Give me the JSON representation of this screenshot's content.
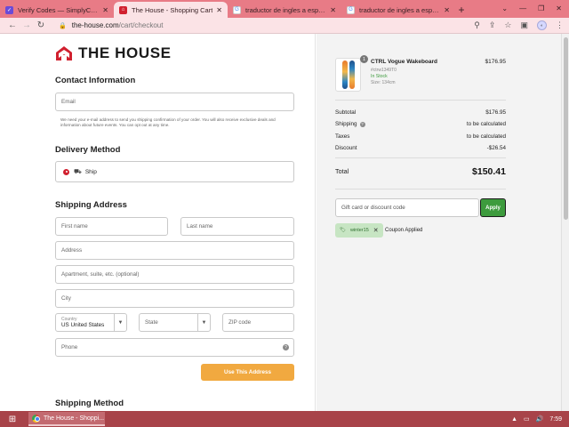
{
  "browser": {
    "tabs": [
      {
        "title": "Verify Codes — SimplyCodes",
        "favicon_color": "#6a4bd8",
        "active": false
      },
      {
        "title": "The House - Shopping Cart",
        "favicon_color": "#d1202f",
        "active": true
      },
      {
        "title": "traductor de ingles a español -",
        "favicon_color": "#4285f4",
        "active": false
      },
      {
        "title": "traductor de ingles a español -",
        "favicon_color": "#4285f4",
        "active": false
      }
    ],
    "new_tab_label": "+",
    "url_domain": "the-house.com",
    "url_path": "/cart/checkout"
  },
  "brand": {
    "name": "THE HOUSE",
    "color": "#d1202f"
  },
  "contact": {
    "heading": "Contact Information",
    "email_placeholder": "Email",
    "note": "We need your e-mail address to send you shipping confirmation of your order. You will also receive exclusive deals and information about future events. You can opt out at any time."
  },
  "delivery": {
    "heading": "Delivery Method",
    "option": "Ship"
  },
  "shipping_address": {
    "heading": "Shipping Address",
    "first_name": "First name",
    "last_name": "Last name",
    "address": "Address",
    "apartment": "Apartment, suite, etc. (optional)",
    "city": "City",
    "country_label": "Country",
    "country_value": "US United States",
    "state": "State",
    "zip": "ZIP code",
    "phone": "Phone",
    "use_button": "Use This Address"
  },
  "shipping_method": {
    "heading": "Shipping Method"
  },
  "order": {
    "item": {
      "quantity": "1",
      "name": "CTRL Vogue Wakeboard",
      "sku": "#ctrw1349T0",
      "stock": "In Stock",
      "size": "Size: 134cm",
      "price": "$176.95"
    },
    "subtotal_label": "Subtotal",
    "subtotal_value": "$176.95",
    "shipping_label": "Shipping",
    "shipping_value": "to be calculated",
    "taxes_label": "Taxes",
    "taxes_value": "to be calculated",
    "discount_label": "Discount",
    "discount_value": "-$26.54",
    "total_label": "Total",
    "total_value": "$150.41",
    "gift_placeholder": "Gift card or discount code",
    "apply_label": "Apply",
    "coupon_code": "winter15",
    "coupon_message": "Coupon Applied"
  },
  "taskbar": {
    "app_label": "The House - Shoppi...",
    "time": "7:59"
  },
  "colors": {
    "accent_orange": "#f1a940",
    "apply_green": "#3d9b3d",
    "tab_strip": "#e87b86",
    "taskbar": "#a84349"
  }
}
